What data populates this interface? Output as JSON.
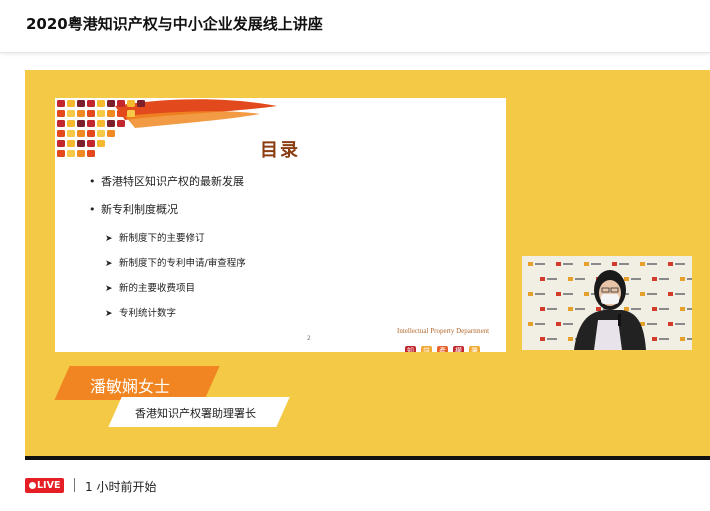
{
  "page": {
    "title": "2020粤港知识产权与中小企业发展线上讲座"
  },
  "slide": {
    "title": "目录",
    "bullets": [
      "香港特区知识产权的最新发展",
      "新专利制度概况"
    ],
    "sub_items": [
      "新制度下的主要修订",
      "新制度下的专利申请/审查程序",
      "新的主要收费项目",
      "专利统计数字"
    ],
    "page_number": "2",
    "dept_en": "Intellectual Property Department",
    "dept_cn": [
      "知",
      "識",
      "產",
      "權",
      "署"
    ],
    "colors": {
      "title": "#8b3d12",
      "dept_cn_bg": [
        "#c1272d",
        "#f0a830",
        "#e8612c",
        "#c1272d",
        "#f0a830"
      ]
    }
  },
  "speaker": {
    "name": "潘敏娴女士",
    "role": "香港知识产权署助理署长",
    "banner_color": "#f08521"
  },
  "player": {
    "background_color": "#f4c945"
  },
  "status": {
    "live_label": "LIVE",
    "live_color": "#e61e26",
    "started_text": "1 小时前开始"
  },
  "icons": {
    "bullet": "bullet-dot",
    "sub_bullet": "arrow-right-icon",
    "live": "record-dot-icon"
  }
}
